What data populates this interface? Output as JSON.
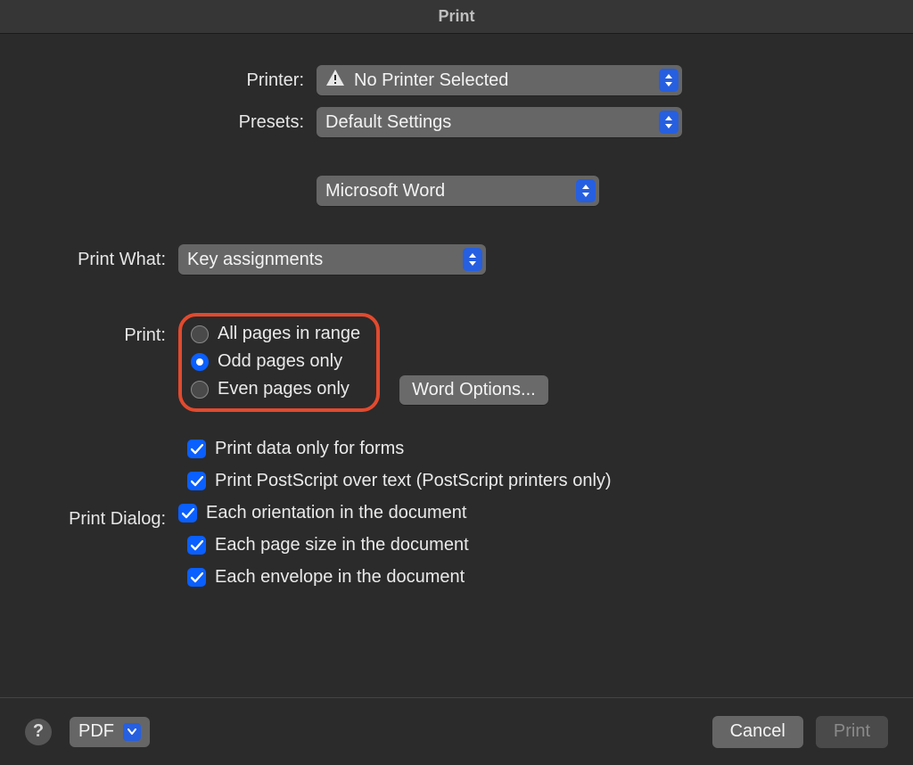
{
  "title": "Print",
  "printer": {
    "label": "Printer:",
    "value": "No Printer Selected"
  },
  "presets": {
    "label": "Presets:",
    "value": "Default Settings"
  },
  "section": {
    "value": "Microsoft Word"
  },
  "printWhat": {
    "label": "Print What:",
    "value": "Key assignments"
  },
  "printRange": {
    "label": "Print:",
    "options": {
      "all": "All pages in range",
      "odd": "Odd pages only",
      "even": "Even pages only"
    },
    "selected": "odd"
  },
  "wordOptions": "Word Options...",
  "checkboxes": {
    "dataOnly": "Print data only for forms",
    "postscript": "Print PostScript over text (PostScript printers only)",
    "orientation": "Each orientation in the document",
    "pageSize": "Each page size in the document",
    "envelope": "Each envelope in the document"
  },
  "printDialogLabel": "Print Dialog:",
  "footer": {
    "help": "?",
    "pdf": "PDF",
    "cancel": "Cancel",
    "print": "Print"
  }
}
